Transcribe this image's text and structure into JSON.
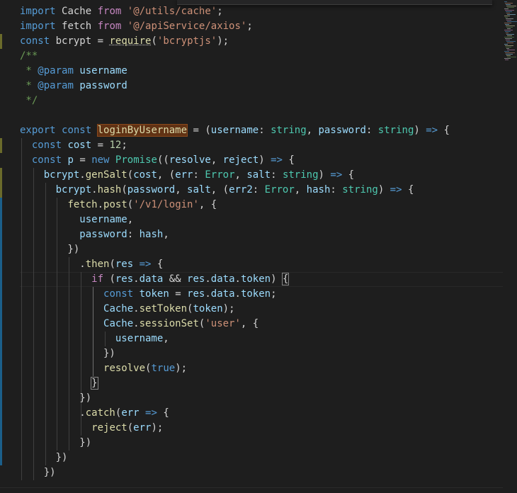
{
  "editor": {
    "lines": [
      [
        [
          "kw",
          "import"
        ],
        [
          "p",
          " "
        ],
        [
          "id",
          "Cache"
        ],
        [
          "p",
          " "
        ],
        [
          "ctl",
          "from"
        ],
        [
          "p",
          " "
        ],
        [
          "s",
          "'@/utils/cache'"
        ],
        [
          "p",
          ";"
        ]
      ],
      [
        [
          "kw",
          "import"
        ],
        [
          "p",
          " "
        ],
        [
          "id",
          "fetch"
        ],
        [
          "p",
          " "
        ],
        [
          "ctl",
          "from"
        ],
        [
          "p",
          " "
        ],
        [
          "s",
          "'@/apiService/axios'"
        ],
        [
          "p",
          ";"
        ]
      ],
      [
        [
          "kw",
          "const"
        ],
        [
          "p",
          " "
        ],
        [
          "id",
          "bcrypt"
        ],
        [
          "p",
          " = "
        ],
        [
          "fnd",
          "require"
        ],
        [
          "p",
          "("
        ],
        [
          "s",
          "'bcryptjs'"
        ],
        [
          "p",
          ");"
        ]
      ],
      [
        [
          "c",
          "/**"
        ]
      ],
      [
        [
          "c",
          " * "
        ],
        [
          "kw",
          "@param"
        ],
        [
          "p",
          " "
        ],
        [
          "v",
          "username"
        ]
      ],
      [
        [
          "c",
          " * "
        ],
        [
          "kw",
          "@param"
        ],
        [
          "p",
          " "
        ],
        [
          "v",
          "password"
        ]
      ],
      [
        [
          "c",
          " */"
        ]
      ],
      [
        [
          "p",
          ""
        ]
      ],
      [
        [
          "kw",
          "export"
        ],
        [
          "p",
          " "
        ],
        [
          "kw",
          "const"
        ],
        [
          "p",
          " "
        ],
        [
          "fnh",
          "loginByUsername"
        ],
        [
          "p",
          " = ("
        ],
        [
          "v",
          "username"
        ],
        [
          "p",
          ": "
        ],
        [
          "t",
          "string"
        ],
        [
          "p",
          ", "
        ],
        [
          "v",
          "password"
        ],
        [
          "p",
          ": "
        ],
        [
          "t",
          "string"
        ],
        [
          "p",
          ") "
        ],
        [
          "kw",
          "=>"
        ],
        [
          "p",
          " {"
        ]
      ],
      [
        [
          "p",
          "  "
        ],
        [
          "kw",
          "const"
        ],
        [
          "p",
          " "
        ],
        [
          "v",
          "cost"
        ],
        [
          "p",
          " = "
        ],
        [
          "n",
          "12"
        ],
        [
          "p",
          ";"
        ]
      ],
      [
        [
          "p",
          "  "
        ],
        [
          "kw",
          "const"
        ],
        [
          "p",
          " "
        ],
        [
          "v",
          "p"
        ],
        [
          "p",
          " = "
        ],
        [
          "kw",
          "new"
        ],
        [
          "p",
          " "
        ],
        [
          "t",
          "Promise"
        ],
        [
          "p",
          "(("
        ],
        [
          "v",
          "resolve"
        ],
        [
          "p",
          ", "
        ],
        [
          "v",
          "reject"
        ],
        [
          "p",
          ") "
        ],
        [
          "kw",
          "=>"
        ],
        [
          "p",
          " {"
        ]
      ],
      [
        [
          "p",
          "    "
        ],
        [
          "v",
          "bcrypt"
        ],
        [
          "p",
          "."
        ],
        [
          "f",
          "genSalt"
        ],
        [
          "p",
          "("
        ],
        [
          "v",
          "cost"
        ],
        [
          "p",
          ", ("
        ],
        [
          "v",
          "err"
        ],
        [
          "p",
          ": "
        ],
        [
          "t",
          "Error"
        ],
        [
          "p",
          ", "
        ],
        [
          "v",
          "salt"
        ],
        [
          "p",
          ": "
        ],
        [
          "t",
          "string"
        ],
        [
          "p",
          ") "
        ],
        [
          "kw",
          "=>"
        ],
        [
          "p",
          " {"
        ]
      ],
      [
        [
          "p",
          "      "
        ],
        [
          "v",
          "bcrypt"
        ],
        [
          "p",
          "."
        ],
        [
          "f",
          "hash"
        ],
        [
          "p",
          "("
        ],
        [
          "v",
          "password"
        ],
        [
          "p",
          ", "
        ],
        [
          "v",
          "salt"
        ],
        [
          "p",
          ", ("
        ],
        [
          "v",
          "err2"
        ],
        [
          "p",
          ": "
        ],
        [
          "t",
          "Error"
        ],
        [
          "p",
          ", "
        ],
        [
          "v",
          "hash"
        ],
        [
          "p",
          ": "
        ],
        [
          "t",
          "string"
        ],
        [
          "p",
          ") "
        ],
        [
          "kw",
          "=>"
        ],
        [
          "p",
          " {"
        ]
      ],
      [
        [
          "p",
          "        "
        ],
        [
          "f",
          "fetch"
        ],
        [
          "p",
          "."
        ],
        [
          "f",
          "post"
        ],
        [
          "p",
          "("
        ],
        [
          "s",
          "'/v1/login'"
        ],
        [
          "p",
          ", {"
        ]
      ],
      [
        [
          "p",
          "          "
        ],
        [
          "v",
          "username"
        ],
        [
          "p",
          ","
        ]
      ],
      [
        [
          "p",
          "          "
        ],
        [
          "v",
          "password"
        ],
        [
          "p",
          ": "
        ],
        [
          "v",
          "hash"
        ],
        [
          "p",
          ","
        ]
      ],
      [
        [
          "p",
          "        })"
        ]
      ],
      [
        [
          "p",
          "          ."
        ],
        [
          "f",
          "then"
        ],
        [
          "p",
          "("
        ],
        [
          "v",
          "res"
        ],
        [
          "p",
          " "
        ],
        [
          "kw",
          "=>"
        ],
        [
          "p",
          " {"
        ]
      ],
      [
        [
          "p",
          "            "
        ],
        [
          "ctl",
          "if"
        ],
        [
          "p",
          " ("
        ],
        [
          "v",
          "res"
        ],
        [
          "p",
          "."
        ],
        [
          "v",
          "data"
        ],
        [
          "p",
          " && "
        ],
        [
          "v",
          "res"
        ],
        [
          "p",
          "."
        ],
        [
          "v",
          "data"
        ],
        [
          "p",
          "."
        ],
        [
          "v",
          "token"
        ],
        [
          "p",
          ") "
        ],
        [
          "bm",
          "{"
        ]
      ],
      [
        [
          "p",
          "              "
        ],
        [
          "kw",
          "const"
        ],
        [
          "p",
          " "
        ],
        [
          "v",
          "token"
        ],
        [
          "p",
          " = "
        ],
        [
          "v",
          "res"
        ],
        [
          "p",
          "."
        ],
        [
          "v",
          "data"
        ],
        [
          "p",
          "."
        ],
        [
          "v",
          "token"
        ],
        [
          "p",
          ";"
        ]
      ],
      [
        [
          "p",
          "              "
        ],
        [
          "v",
          "Cache"
        ],
        [
          "p",
          "."
        ],
        [
          "f",
          "setToken"
        ],
        [
          "p",
          "("
        ],
        [
          "v",
          "token"
        ],
        [
          "p",
          ");"
        ]
      ],
      [
        [
          "p",
          "              "
        ],
        [
          "v",
          "Cache"
        ],
        [
          "p",
          "."
        ],
        [
          "f",
          "sessionSet"
        ],
        [
          "p",
          "("
        ],
        [
          "s",
          "'user'"
        ],
        [
          "p",
          ", {"
        ]
      ],
      [
        [
          "p",
          "                "
        ],
        [
          "v",
          "username"
        ],
        [
          "p",
          ","
        ]
      ],
      [
        [
          "p",
          "              })"
        ]
      ],
      [
        [
          "p",
          "              "
        ],
        [
          "f",
          "resolve"
        ],
        [
          "p",
          "("
        ],
        [
          "kw",
          "true"
        ],
        [
          "p",
          ");"
        ]
      ],
      [
        [
          "p",
          "            "
        ],
        [
          "bm",
          "}"
        ]
      ],
      [
        [
          "p",
          "          })"
        ]
      ],
      [
        [
          "p",
          "          ."
        ],
        [
          "f",
          "catch"
        ],
        [
          "p",
          "("
        ],
        [
          "v",
          "err"
        ],
        [
          "p",
          " "
        ],
        [
          "kw",
          "=>"
        ],
        [
          "p",
          " {"
        ]
      ],
      [
        [
          "p",
          "            "
        ],
        [
          "f",
          "reject"
        ],
        [
          "p",
          "("
        ],
        [
          "v",
          "err"
        ],
        [
          "p",
          ");"
        ]
      ],
      [
        [
          "p",
          "          })"
        ]
      ],
      [
        [
          "p",
          "      })"
        ]
      ],
      [
        [
          "p",
          "    })"
        ]
      ]
    ]
  },
  "colors": {
    "background": "#1e1e1e",
    "gutter_modified": "#6b6b2b",
    "gutter_added": "#1b5f8a"
  }
}
